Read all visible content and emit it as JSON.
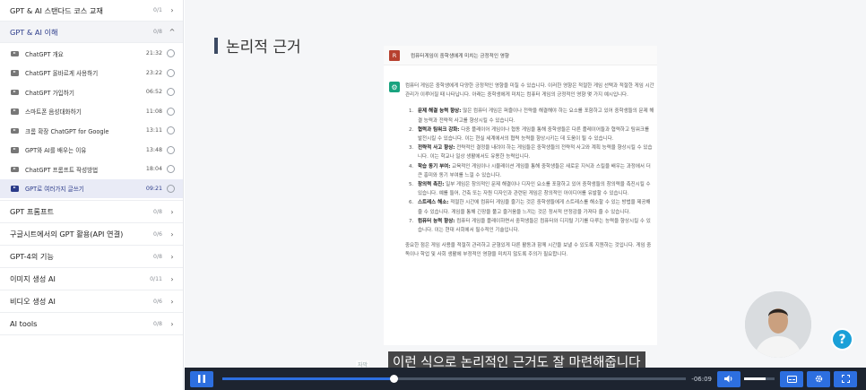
{
  "sidebar": {
    "top_sections": [
      {
        "title": "GPT & AI 스탠다드 코스 교재",
        "count": "0/1",
        "chevron": "›"
      },
      {
        "title": "GPT & AI 이해",
        "count": "0/8",
        "chevron": "^"
      }
    ],
    "lessons": [
      {
        "title": "ChatGPT 개요",
        "duration": "21:32"
      },
      {
        "title": "ChatGPT 올바르게 사용하기",
        "duration": "23:22"
      },
      {
        "title": "ChatGPT 가입하기",
        "duration": "06:52"
      },
      {
        "title": "스마트폰 음성대화하기",
        "duration": "11:08"
      },
      {
        "title": "크롬 확장 ChatGPT for Google",
        "duration": "13:11"
      },
      {
        "title": "GPT와 AI를 배우는 이유",
        "duration": "13:48"
      },
      {
        "title": "ChatGPT 프롬프트 작성방법",
        "duration": "18:04"
      },
      {
        "title": "GPT로 여러가지 글쓰기",
        "duration": "09:21"
      }
    ],
    "bottom_sections": [
      {
        "title": "GPT 프롬프트",
        "count": "0/8",
        "chevron": "›"
      },
      {
        "title": "구글시트에서의 GPT 활용(API 연결)",
        "count": "0/6",
        "chevron": "›"
      },
      {
        "title": "GPT-4의 기능",
        "count": "0/8",
        "chevron": "›"
      },
      {
        "title": "이미지 생성 AI",
        "count": "0/11",
        "chevron": "›"
      },
      {
        "title": "비디오 생성 AI",
        "count": "0/6",
        "chevron": "›"
      },
      {
        "title": "AI tools",
        "count": "0/8",
        "chevron": "›"
      }
    ]
  },
  "slide": {
    "title": "논리적 근거",
    "user_avatar": "R",
    "prompt": "컴퓨터게임이 중학생에게 미치는 긍정적인 영향",
    "gpt_icon": "⚙",
    "intro": "컴퓨터 게임은 중학생에게 다양한 긍정적인 영향을 미칠 수 있습니다. 이러한 영향은 적절한 게임 선택과 적절한 게임 시간 관리가 이루어질 때 나타납니다. 아래는 중학생에게 미치는 컴퓨터 게임의 긍정적인 영향 몇 가지 예시입니다.",
    "points": [
      {
        "num": "1.",
        "bold": "문제 해결 능력 향상:",
        "text": " 많은 컴퓨터 게임은 퍼즐이나 전략을 해결해야 하는 요소를 포함하고 있어 중학생들의 문제 해결 능력과 전략적 사고를 향상시킬 수 있습니다."
      },
      {
        "num": "2.",
        "bold": "협력과 팀워크 강화:",
        "text": " 다중 플레이어 게임이나 협동 게임을 통해 중학생들은 다른 플레이어들과 협력하고 팀워크를 발전시킬 수 있습니다. 이는 현실 세계에서의 협력 능력을 향상시키는 데 도움이 될 수 있습니다."
      },
      {
        "num": "3.",
        "bold": "전략적 사고 향상:",
        "text": " 전략적인 결정을 내려야 하는 게임들은 중학생들의 전략적 사고와 계획 능력을 향상시킬 수 있습니다. 이는 학교나 일상 생활에서도 유용한 능력입니다."
      },
      {
        "num": "4.",
        "bold": "학습 동기 부여:",
        "text": " 교육적인 게임이나 시뮬레이션 게임을 통해 중학생들은 새로운 지식과 스킬을 배우는 과정에서 더 큰 흥미와 동기 부여를 느낄 수 있습니다."
      },
      {
        "num": "5.",
        "bold": "창의력 촉진:",
        "text": " 일부 게임은 창의적인 문제 해결이나 디자인 요소를 포함하고 있어 중학생들의 창의력을 촉진시킬 수 있습니다. 예를 들어, 건축 또는 자원 디자인과 관련된 게임은 창의적인 아이디어를 유발할 수 있습니다."
      },
      {
        "num": "6.",
        "bold": "스트레스 해소:",
        "text": " 적절한 시간에 컴퓨터 게임을 즐기는 것은 중학생들에게 스트레스를 해소할 수 있는 방법을 제공해줄 수 있습니다. 게임을 통해 긴장을 풀고 즐거움을 느끼는 것은 정서적 안정감을 가져다 줄 수 있습니다."
      },
      {
        "num": "7.",
        "bold": "컴퓨터 능력 향상:",
        "text": " 컴퓨터 게임을 플레이하면서 중학생들은 컴퓨터와 디지털 기기를 다루는 능력을 향상시킬 수 있습니다. 이는 현대 사회에서 필수적인 기술입니다."
      }
    ],
    "outro": "중요한 점은 게임 사용을 적절히 관리하고 균형있게 다른 활동과 함께 시간을 보낼 수 있도록 지원하는 것입니다. 게임 중독이나 학업 및 사회 생활에 부정적인 영향을 미치지 않도록 주의가 필요합니다."
  },
  "player": {
    "subtitle": "이런 식으로 논리적인 근거도 잘 마련해줍니다",
    "subtitle_tag": "자막",
    "time_remaining": "-06:09",
    "progress": 0.37,
    "volume": 0.7,
    "help_icon": "?"
  },
  "colors": {
    "accent": "#2b3b8a",
    "button": "#2d6fe0",
    "control_bar": "#1d2430",
    "help": "#1aa0d8"
  }
}
